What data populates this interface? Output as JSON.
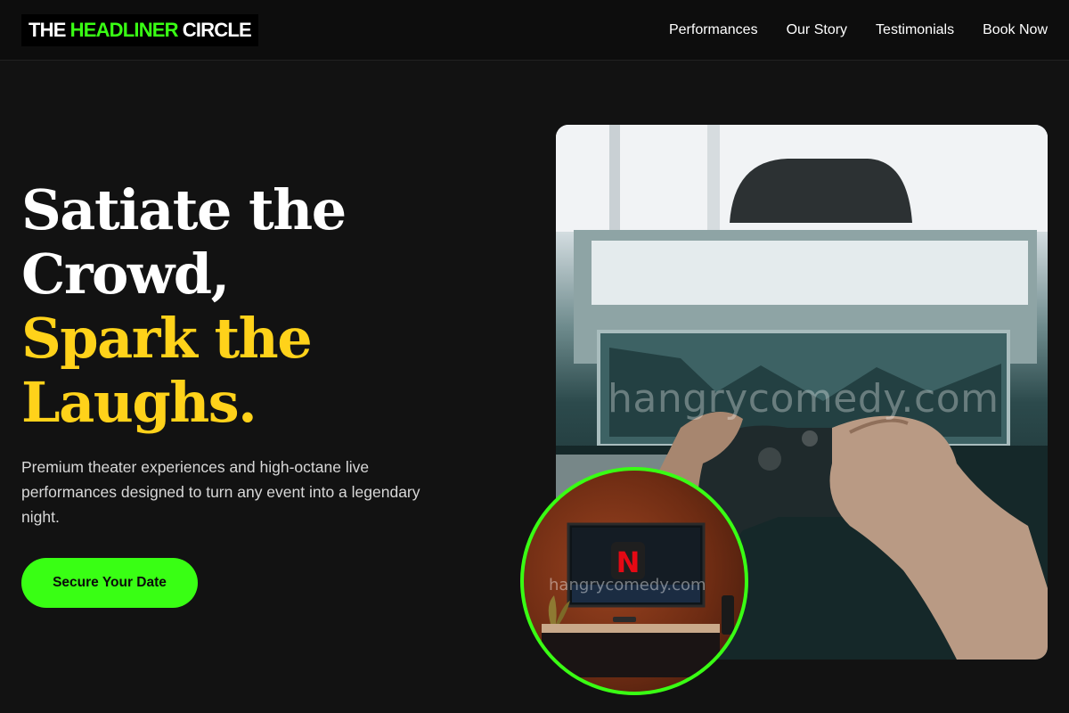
{
  "brand": {
    "part1": "THE",
    "part2": "HEADLINER",
    "part3": "CIRCLE",
    "accent_color": "#39ff14"
  },
  "nav": {
    "items": [
      {
        "label": "Performances"
      },
      {
        "label": "Our Story"
      },
      {
        "label": "Testimonials"
      },
      {
        "label": "Book Now"
      }
    ]
  },
  "hero": {
    "headline_lines": [
      "Satiate the",
      "Crowd,",
      "Spark the",
      "Laughs."
    ],
    "highlight_color": "#ffd21a",
    "subtitle": "Premium theater experiences and high-octane live performances designed to turn any event into a legendary night.",
    "cta_label": "Secure Your Date"
  },
  "images": {
    "main_watermark": "hangrycomedy.com",
    "circle_watermark": "hangrycomedy.com",
    "main_icon": "game-controller-photo",
    "circle_icon": "tv-streaming-photo"
  }
}
